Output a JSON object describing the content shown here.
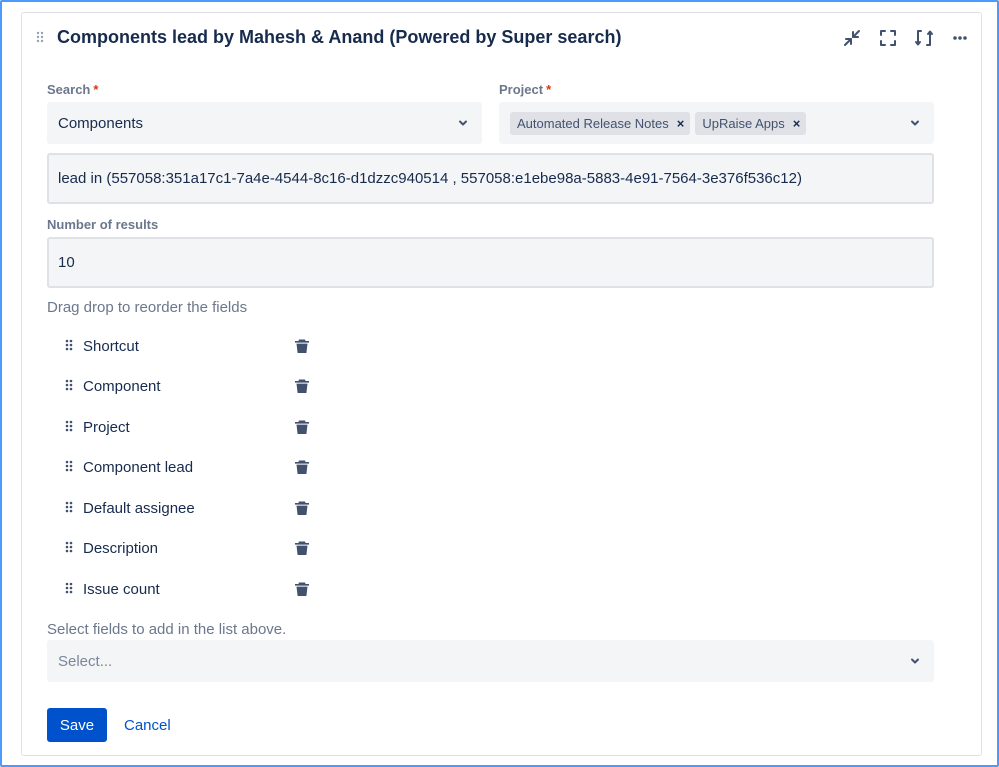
{
  "gadget": {
    "title": "Components lead by Mahesh & Anand (Powered by Super search)",
    "header_icons": [
      "minimize-icon",
      "fullscreen-icon",
      "refresh-icon",
      "more-icon"
    ]
  },
  "form": {
    "search": {
      "label": "Search",
      "required_mark": "*",
      "value": "Components"
    },
    "project": {
      "label": "Project",
      "required_mark": "*",
      "tags": [
        "Automated Release Notes",
        "UpRaise Apps"
      ],
      "remove_glyph": "×"
    },
    "query": {
      "value": "lead in (557058:351a17c1-7a4e-4544-8c16-d1dzzc940514 , 557058:e1ebe98a-5883-4e91-7564-3e376f536c12)"
    },
    "num_results": {
      "label": "Number of results",
      "value": "10"
    },
    "reorder_hint": "Drag drop to reorder the fields",
    "fields": [
      "Shortcut",
      "Component",
      "Project",
      "Component lead",
      "Default assignee",
      "Description",
      "Issue count"
    ],
    "add_fields_hint": "Select fields to add in the list above.",
    "add_fields_select": {
      "placeholder": "Select..."
    }
  },
  "actions": {
    "save_label": "Save",
    "cancel_label": "Cancel"
  },
  "colors": {
    "primary": "#0052cc",
    "focus_border": "#4c9aff",
    "required": "#de350b",
    "input_bg": "#f4f5f7",
    "tag_bg": "#dfe1e6"
  }
}
